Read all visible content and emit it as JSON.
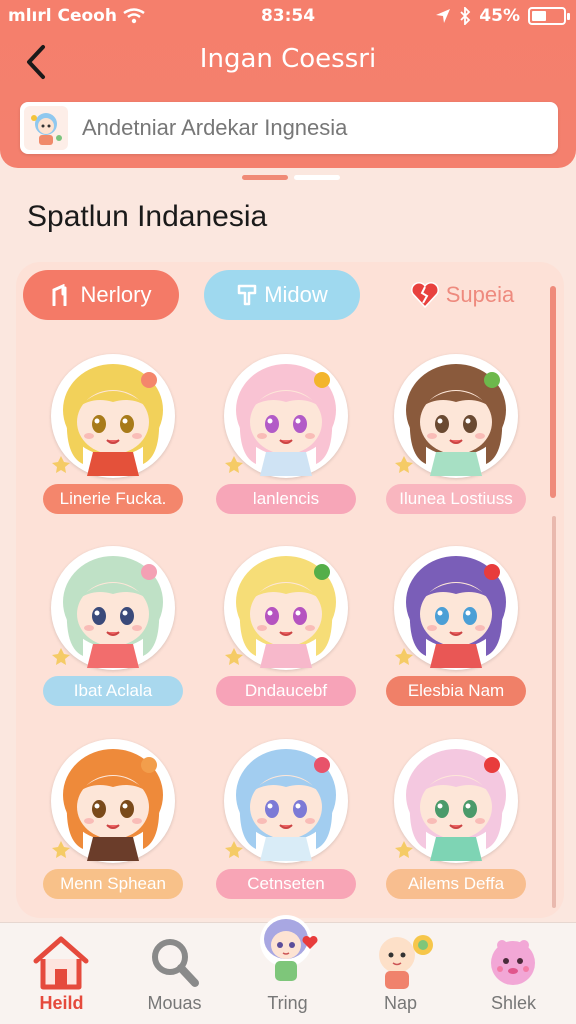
{
  "status_bar": {
    "carrier": "mlırl Ceooh",
    "time": "83:54",
    "battery": "45%",
    "battery_level": 0.45
  },
  "header": {
    "back_icon": "chevron-left-icon",
    "title": "Ingan Coessri"
  },
  "search": {
    "value": "Andetniar Ardekar Ingnesia"
  },
  "section_title": "Spatlun Indanesia",
  "tabs": [
    {
      "label": "Nerlory",
      "icon": "flag-icon",
      "bg": "#f47a67",
      "color": "#ffffff"
    },
    {
      "label": "Midow",
      "icon": "bookmark-icon",
      "bg": "#9fd9ef",
      "color": "#ffffff"
    },
    {
      "label": "Supeia",
      "icon": "broken-heart-icon",
      "bg": "transparent",
      "color": "#ee8a7e"
    }
  ],
  "characters": [
    {
      "name": "Linerie Fucka.",
      "pill": "#f4866c",
      "hair": "#f2d15a",
      "eye": "#a87b1a",
      "outfit": "#e4513a",
      "accent": "#f4866c"
    },
    {
      "name": "lanlencis",
      "pill": "#f7a6b8",
      "hair": "#f9c3d3",
      "eye": "#b25bc7",
      "outfit": "#cfe3f4",
      "accent": "#f3b52c"
    },
    {
      "name": "Ilunea Lostiuss",
      "pill": "#f9b6bf",
      "hair": "#8a5a3c",
      "eye": "#6a4a32",
      "outfit": "#a7e0c4",
      "accent": "#6db94c"
    },
    {
      "name": "Ibat Aclala",
      "pill": "#a9d8ee",
      "hair": "#bfe1c6",
      "eye": "#3a4a7a",
      "outfit": "#f26d6d",
      "accent": "#f4a0b4"
    },
    {
      "name": "Dndaucebf",
      "pill": "#f7a3b8",
      "hair": "#f6dd77",
      "eye": "#b553c0",
      "outfit": "#f7b8cb",
      "accent": "#55ae49"
    },
    {
      "name": "Elesbia Nam",
      "pill": "#f08068",
      "hair": "#7a5eb8",
      "eye": "#4b9fd6",
      "outfit": "#e95755",
      "accent": "#e83c3c"
    },
    {
      "name": "Menn Sphean",
      "pill": "#f8c189",
      "hair": "#ee8a3a",
      "eye": "#7a4a1a",
      "outfit": "#6b3d2a",
      "accent": "#f29e4c"
    },
    {
      "name": "Cetnseten",
      "pill": "#f8a5b6",
      "hair": "#a2cdf0",
      "eye": "#7c7ad6",
      "outfit": "#d9ecf7",
      "accent": "#e8536a"
    },
    {
      "name": "Ailems Deffa",
      "pill": "#f8be8f",
      "hair": "#f4c8e0",
      "eye": "#4a9a6a",
      "outfit": "#7ed4b4",
      "accent": "#e83c3c"
    }
  ],
  "bottom_nav": [
    {
      "label": "Heild",
      "icon": "home-icon",
      "active": true
    },
    {
      "label": "Mouas",
      "icon": "search-icon",
      "active": false
    },
    {
      "label": "Tring",
      "icon": "chibi-avatar-icon",
      "active": false
    },
    {
      "label": "Nap",
      "icon": "baby-icon",
      "active": false
    },
    {
      "label": "Shlek",
      "icon": "pink-blob-icon",
      "active": false
    }
  ],
  "colors": {
    "accent": "#f47a67",
    "active_nav": "#e54a3c",
    "panel_bg": "#fde1d7"
  }
}
